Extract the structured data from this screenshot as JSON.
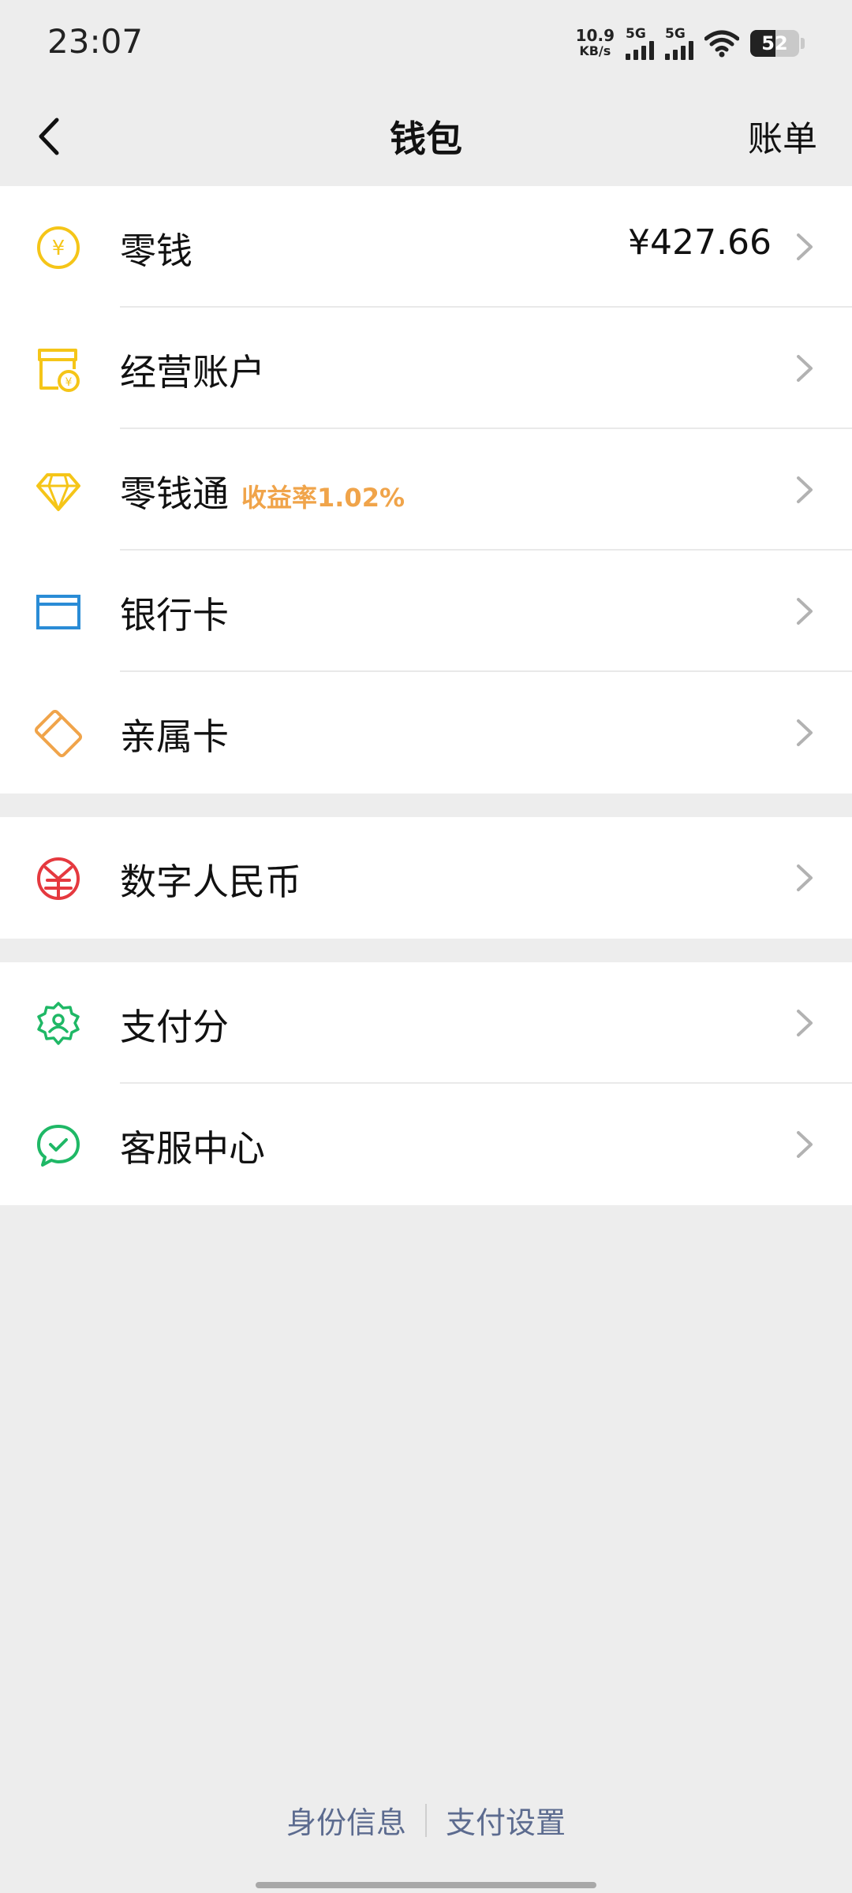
{
  "status_bar": {
    "time": "23:07",
    "net_speed_value": "10.9",
    "net_speed_unit": "KB/s",
    "sim1": "5G",
    "sim2": "5G",
    "battery": "52",
    "battery_level": 0.52
  },
  "nav": {
    "back_icon": "chevron-left-icon",
    "title": "钱包",
    "right_label": "账单"
  },
  "groups": [
    {
      "items": [
        {
          "label": "零钱",
          "value": "¥427.66",
          "icon": "yuan-coin-icon"
        },
        {
          "label": "经营账户",
          "icon": "shop-account-icon"
        },
        {
          "label": "零钱通",
          "badge": "收益率1.02%",
          "icon": "diamond-icon"
        },
        {
          "label": "银行卡",
          "icon": "bank-card-icon"
        },
        {
          "label": "亲属卡",
          "icon": "family-card-icon"
        }
      ]
    },
    {
      "items": [
        {
          "label": "数字人民币",
          "icon": "digital-rmb-icon"
        }
      ]
    },
    {
      "items": [
        {
          "label": "支付分",
          "icon": "pay-score-icon"
        },
        {
          "label": "客服中心",
          "icon": "customer-service-icon"
        }
      ]
    }
  ],
  "footer": {
    "link1": "身份信息",
    "link2": "支付设置"
  },
  "colors": {
    "background": "#ededed",
    "yellow": "#f5c518",
    "blue": "#2a8cd6",
    "orange": "#f0a44a",
    "red": "#e5393f",
    "green": "#1fb866",
    "link": "#5c6b8f"
  }
}
